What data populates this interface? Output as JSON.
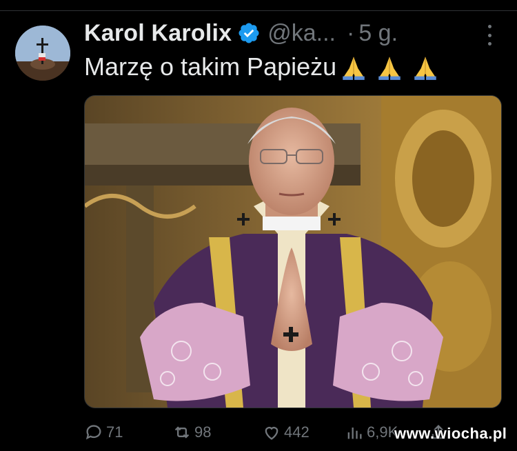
{
  "tweet": {
    "author_name": "Karol Karolix",
    "author_handle": "@ka...",
    "separator": "·",
    "time": "5 g.",
    "text": "Marzę o takim Papieżu",
    "emoji": [
      "folded-hands",
      "folded-hands",
      "folded-hands"
    ]
  },
  "actions": {
    "replies": "71",
    "reposts": "98",
    "likes": "442",
    "views": "6,9K"
  },
  "watermark": "www.wiocha.pl",
  "colors": {
    "background": "#000000",
    "text": "#e7e9ea",
    "muted": "#71767b",
    "verified": "#1d9bf0"
  },
  "icons": [
    "verified-badge-icon",
    "more-icon",
    "reply-icon",
    "repost-icon",
    "like-icon",
    "views-icon",
    "share-icon"
  ]
}
